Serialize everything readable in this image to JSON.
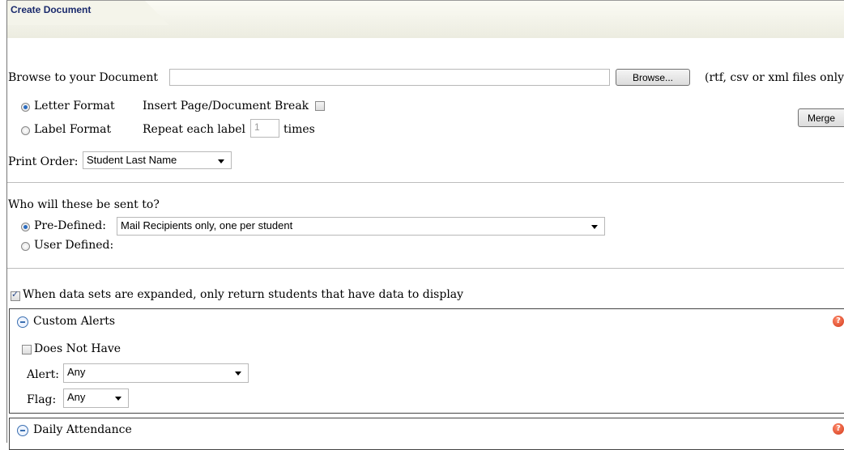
{
  "tab": {
    "title": "Create Document"
  },
  "document": {
    "browse_label": "Browse to your Document",
    "file_value": "",
    "browse_button": "Browse...",
    "file_types": "(rtf, csv or xml files only"
  },
  "format": {
    "letter_label": "Letter Format",
    "label_label": "Label Format",
    "selected": "letter",
    "page_break_label": "Insert Page/Document Break",
    "page_break_checked": false,
    "repeat_label": "Repeat each label",
    "repeat_value": "1",
    "repeat_suffix": "times",
    "merge_button": "Merge"
  },
  "print_order": {
    "label": "Print Order:",
    "value": "Student Last Name"
  },
  "recipients": {
    "question": "Who will these be sent to?",
    "predefined_label": "Pre-Defined:",
    "predefined_value": "Mail Recipients only, one per student",
    "userdefined_label": "User Defined:",
    "selected": "predefined"
  },
  "data_sets": {
    "label": "When data sets are expanded, only return students that have data to display",
    "checked": true
  },
  "custom_alerts": {
    "title": "Custom Alerts",
    "does_not_have_label": "Does Not Have",
    "alert_label": "Alert:",
    "alert_value": "Any",
    "flag_label": "Flag:",
    "flag_value": "Any"
  },
  "daily_attendance": {
    "title": "Daily Attendance"
  },
  "help_icon_glyph": "?"
}
